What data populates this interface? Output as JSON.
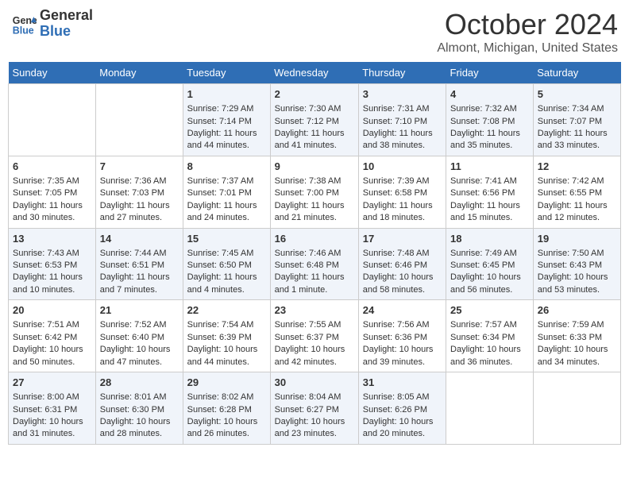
{
  "header": {
    "logo_line1": "General",
    "logo_line2": "Blue",
    "month_title": "October 2024",
    "subtitle": "Almont, Michigan, United States"
  },
  "days_of_week": [
    "Sunday",
    "Monday",
    "Tuesday",
    "Wednesday",
    "Thursday",
    "Friday",
    "Saturday"
  ],
  "weeks": [
    [
      {
        "day": "",
        "sunrise": "",
        "sunset": "",
        "daylight": ""
      },
      {
        "day": "",
        "sunrise": "",
        "sunset": "",
        "daylight": ""
      },
      {
        "day": "1",
        "sunrise": "Sunrise: 7:29 AM",
        "sunset": "Sunset: 7:14 PM",
        "daylight": "Daylight: 11 hours and 44 minutes."
      },
      {
        "day": "2",
        "sunrise": "Sunrise: 7:30 AM",
        "sunset": "Sunset: 7:12 PM",
        "daylight": "Daylight: 11 hours and 41 minutes."
      },
      {
        "day": "3",
        "sunrise": "Sunrise: 7:31 AM",
        "sunset": "Sunset: 7:10 PM",
        "daylight": "Daylight: 11 hours and 38 minutes."
      },
      {
        "day": "4",
        "sunrise": "Sunrise: 7:32 AM",
        "sunset": "Sunset: 7:08 PM",
        "daylight": "Daylight: 11 hours and 35 minutes."
      },
      {
        "day": "5",
        "sunrise": "Sunrise: 7:34 AM",
        "sunset": "Sunset: 7:07 PM",
        "daylight": "Daylight: 11 hours and 33 minutes."
      }
    ],
    [
      {
        "day": "6",
        "sunrise": "Sunrise: 7:35 AM",
        "sunset": "Sunset: 7:05 PM",
        "daylight": "Daylight: 11 hours and 30 minutes."
      },
      {
        "day": "7",
        "sunrise": "Sunrise: 7:36 AM",
        "sunset": "Sunset: 7:03 PM",
        "daylight": "Daylight: 11 hours and 27 minutes."
      },
      {
        "day": "8",
        "sunrise": "Sunrise: 7:37 AM",
        "sunset": "Sunset: 7:01 PM",
        "daylight": "Daylight: 11 hours and 24 minutes."
      },
      {
        "day": "9",
        "sunrise": "Sunrise: 7:38 AM",
        "sunset": "Sunset: 7:00 PM",
        "daylight": "Daylight: 11 hours and 21 minutes."
      },
      {
        "day": "10",
        "sunrise": "Sunrise: 7:39 AM",
        "sunset": "Sunset: 6:58 PM",
        "daylight": "Daylight: 11 hours and 18 minutes."
      },
      {
        "day": "11",
        "sunrise": "Sunrise: 7:41 AM",
        "sunset": "Sunset: 6:56 PM",
        "daylight": "Daylight: 11 hours and 15 minutes."
      },
      {
        "day": "12",
        "sunrise": "Sunrise: 7:42 AM",
        "sunset": "Sunset: 6:55 PM",
        "daylight": "Daylight: 11 hours and 12 minutes."
      }
    ],
    [
      {
        "day": "13",
        "sunrise": "Sunrise: 7:43 AM",
        "sunset": "Sunset: 6:53 PM",
        "daylight": "Daylight: 11 hours and 10 minutes."
      },
      {
        "day": "14",
        "sunrise": "Sunrise: 7:44 AM",
        "sunset": "Sunset: 6:51 PM",
        "daylight": "Daylight: 11 hours and 7 minutes."
      },
      {
        "day": "15",
        "sunrise": "Sunrise: 7:45 AM",
        "sunset": "Sunset: 6:50 PM",
        "daylight": "Daylight: 11 hours and 4 minutes."
      },
      {
        "day": "16",
        "sunrise": "Sunrise: 7:46 AM",
        "sunset": "Sunset: 6:48 PM",
        "daylight": "Daylight: 11 hours and 1 minute."
      },
      {
        "day": "17",
        "sunrise": "Sunrise: 7:48 AM",
        "sunset": "Sunset: 6:46 PM",
        "daylight": "Daylight: 10 hours and 58 minutes."
      },
      {
        "day": "18",
        "sunrise": "Sunrise: 7:49 AM",
        "sunset": "Sunset: 6:45 PM",
        "daylight": "Daylight: 10 hours and 56 minutes."
      },
      {
        "day": "19",
        "sunrise": "Sunrise: 7:50 AM",
        "sunset": "Sunset: 6:43 PM",
        "daylight": "Daylight: 10 hours and 53 minutes."
      }
    ],
    [
      {
        "day": "20",
        "sunrise": "Sunrise: 7:51 AM",
        "sunset": "Sunset: 6:42 PM",
        "daylight": "Daylight: 10 hours and 50 minutes."
      },
      {
        "day": "21",
        "sunrise": "Sunrise: 7:52 AM",
        "sunset": "Sunset: 6:40 PM",
        "daylight": "Daylight: 10 hours and 47 minutes."
      },
      {
        "day": "22",
        "sunrise": "Sunrise: 7:54 AM",
        "sunset": "Sunset: 6:39 PM",
        "daylight": "Daylight: 10 hours and 44 minutes."
      },
      {
        "day": "23",
        "sunrise": "Sunrise: 7:55 AM",
        "sunset": "Sunset: 6:37 PM",
        "daylight": "Daylight: 10 hours and 42 minutes."
      },
      {
        "day": "24",
        "sunrise": "Sunrise: 7:56 AM",
        "sunset": "Sunset: 6:36 PM",
        "daylight": "Daylight: 10 hours and 39 minutes."
      },
      {
        "day": "25",
        "sunrise": "Sunrise: 7:57 AM",
        "sunset": "Sunset: 6:34 PM",
        "daylight": "Daylight: 10 hours and 36 minutes."
      },
      {
        "day": "26",
        "sunrise": "Sunrise: 7:59 AM",
        "sunset": "Sunset: 6:33 PM",
        "daylight": "Daylight: 10 hours and 34 minutes."
      }
    ],
    [
      {
        "day": "27",
        "sunrise": "Sunrise: 8:00 AM",
        "sunset": "Sunset: 6:31 PM",
        "daylight": "Daylight: 10 hours and 31 minutes."
      },
      {
        "day": "28",
        "sunrise": "Sunrise: 8:01 AM",
        "sunset": "Sunset: 6:30 PM",
        "daylight": "Daylight: 10 hours and 28 minutes."
      },
      {
        "day": "29",
        "sunrise": "Sunrise: 8:02 AM",
        "sunset": "Sunset: 6:28 PM",
        "daylight": "Daylight: 10 hours and 26 minutes."
      },
      {
        "day": "30",
        "sunrise": "Sunrise: 8:04 AM",
        "sunset": "Sunset: 6:27 PM",
        "daylight": "Daylight: 10 hours and 23 minutes."
      },
      {
        "day": "31",
        "sunrise": "Sunrise: 8:05 AM",
        "sunset": "Sunset: 6:26 PM",
        "daylight": "Daylight: 10 hours and 20 minutes."
      },
      {
        "day": "",
        "sunrise": "",
        "sunset": "",
        "daylight": ""
      },
      {
        "day": "",
        "sunrise": "",
        "sunset": "",
        "daylight": ""
      }
    ]
  ]
}
